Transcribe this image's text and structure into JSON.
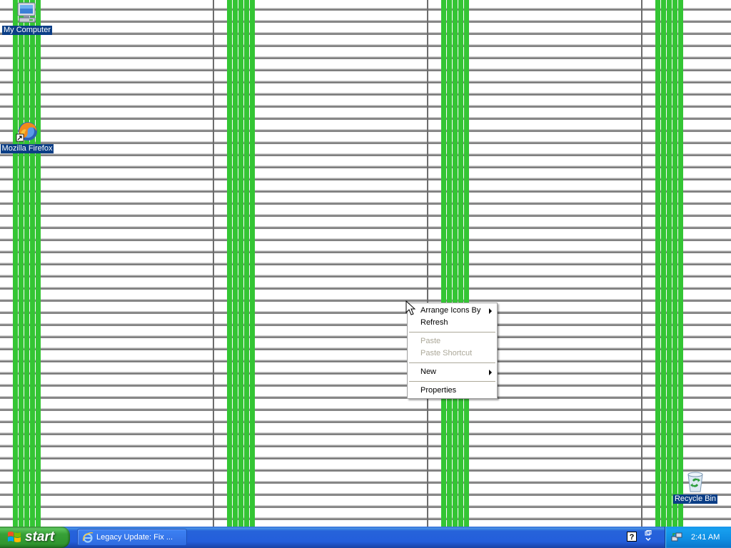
{
  "desktop": {
    "icons": [
      {
        "label": "My Computer",
        "icon": "my-computer-icon"
      },
      {
        "label": "Mozilla Firefox",
        "icon": "firefox-icon"
      },
      {
        "label": "Recycle Bin",
        "icon": "recycle-bin-icon"
      }
    ]
  },
  "context_menu": {
    "items": [
      {
        "label": "Arrange Icons By",
        "enabled": true,
        "submenu": true
      },
      {
        "label": "Refresh",
        "enabled": true,
        "submenu": false
      },
      {
        "label": "Paste",
        "enabled": false,
        "submenu": false
      },
      {
        "label": "Paste Shortcut",
        "enabled": false,
        "submenu": false
      },
      {
        "label": "New",
        "enabled": true,
        "submenu": true
      },
      {
        "label": "Properties",
        "enabled": true,
        "submenu": false
      }
    ]
  },
  "taskbar": {
    "start_label": "start",
    "tasks": [
      {
        "label": "Legacy Update: Fix ...",
        "icon": "internet-explorer-icon"
      }
    ],
    "tray": {
      "clock": "2:41 AM",
      "icons": [
        "help-icon",
        "network-icon"
      ]
    }
  },
  "colors": {
    "taskbar_blue": "#245edb",
    "start_green": "#37a037",
    "selection_blue": "#0b3e86",
    "wallpaper_green": "#34c534"
  }
}
